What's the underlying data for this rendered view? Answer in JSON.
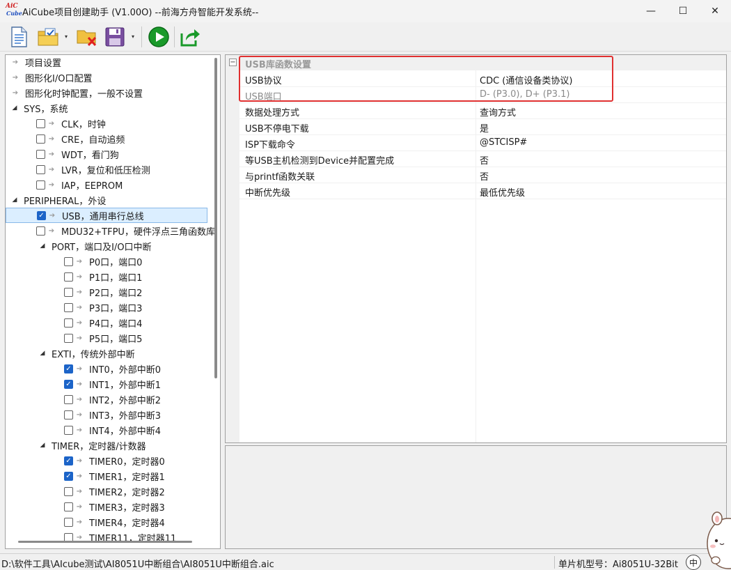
{
  "window": {
    "logo_top": "AiC",
    "logo_bottom": "Cube",
    "title": "AiCube项目创建助手 (V1.00O) --前海方舟智能开发系统--",
    "minimize_glyph": "—",
    "maximize_glyph": "☐",
    "close_glyph": "✕"
  },
  "toolbar": {
    "buttons": [
      "new-project-icon",
      "open-project-icon",
      "close-project-icon",
      "save-project-icon",
      "run-icon",
      "export-icon"
    ],
    "dropdown_glyph": "▾"
  },
  "tree": {
    "items": [
      {
        "label": "项目设置",
        "kind": "arrow"
      },
      {
        "label": "图形化I/O口配置",
        "kind": "arrow"
      },
      {
        "label": "图形化时钟配置，一般不设置",
        "kind": "arrow"
      },
      {
        "label": "SYS，系统",
        "kind": "expander"
      },
      {
        "label": "CLK，时钟",
        "kind": "check",
        "checked": false
      },
      {
        "label": "CRE，自动追频",
        "kind": "check",
        "checked": false
      },
      {
        "label": "WDT，看门狗",
        "kind": "check",
        "checked": false
      },
      {
        "label": "LVR，复位和低压检测",
        "kind": "check",
        "checked": false
      },
      {
        "label": "IAP，EEPROM",
        "kind": "check",
        "checked": false
      },
      {
        "label": "PERIPHERAL，外设",
        "kind": "expander"
      },
      {
        "label": "USB，通用串行总线",
        "kind": "check",
        "checked": true,
        "selected": true
      },
      {
        "label": "MDU32+TFPU，硬件浮点三角函数库",
        "kind": "check",
        "checked": false
      },
      {
        "label": "PORT，端口及I/O口中断",
        "kind": "expander"
      },
      {
        "label": "P0口，端口0",
        "kind": "check",
        "checked": false
      },
      {
        "label": "P1口，端口1",
        "kind": "check",
        "checked": false
      },
      {
        "label": "P2口，端口2",
        "kind": "check",
        "checked": false
      },
      {
        "label": "P3口，端口3",
        "kind": "check",
        "checked": false
      },
      {
        "label": "P4口，端口4",
        "kind": "check",
        "checked": false
      },
      {
        "label": "P5口，端口5",
        "kind": "check",
        "checked": false
      },
      {
        "label": "EXTI，传统外部中断",
        "kind": "expander"
      },
      {
        "label": "INT0，外部中断0",
        "kind": "check",
        "checked": true
      },
      {
        "label": "INT1，外部中断1",
        "kind": "check",
        "checked": true
      },
      {
        "label": "INT2，外部中断2",
        "kind": "check",
        "checked": false
      },
      {
        "label": "INT3，外部中断3",
        "kind": "check",
        "checked": false
      },
      {
        "label": "INT4，外部中断4",
        "kind": "check",
        "checked": false
      },
      {
        "label": "TIMER，定时器/计数器",
        "kind": "expander"
      },
      {
        "label": "TIMER0，定时器0",
        "kind": "check",
        "checked": true
      },
      {
        "label": "TIMER1，定时器1",
        "kind": "check",
        "checked": true
      },
      {
        "label": "TIMER2，定时器2",
        "kind": "check",
        "checked": false
      },
      {
        "label": "TIMER3，定时器3",
        "kind": "check",
        "checked": false
      },
      {
        "label": "TIMER4，定时器4",
        "kind": "check",
        "checked": false
      },
      {
        "label": "TIMER11，定时器11",
        "kind": "check",
        "checked": false
      }
    ]
  },
  "properties": {
    "category": "USB库函数设置",
    "collapse_glyph": "−",
    "rows": [
      {
        "name": "USB协议",
        "value": "CDC (通信设备类协议)",
        "readonly": false
      },
      {
        "name": "USB端口",
        "value": "D- (P3.0), D+ (P3.1)",
        "readonly": true
      },
      {
        "name": "数据处理方式",
        "value": "查询方式",
        "readonly": false
      },
      {
        "name": "USB不停电下载",
        "value": "是",
        "readonly": false
      },
      {
        "name": "ISP下载命令",
        "value": "@STCISP#",
        "readonly": false
      },
      {
        "name": "等USB主机检测到Device并配置完成",
        "value": "否",
        "readonly": false
      },
      {
        "name": "与printf函数关联",
        "value": "否",
        "readonly": false
      },
      {
        "name": "中断优先级",
        "value": "最低优先级",
        "readonly": false
      }
    ]
  },
  "status": {
    "path": "D:\\软件工具\\AIcube测试\\AI8051U中断组合\\AI8051U中断组合.aic",
    "mcu": "单片机型号：Ai8051U-32Bit",
    "ime": "中"
  },
  "colors": {
    "highlight": "#e03030",
    "check_blue": "#1c64c8",
    "selected_bg": "#dbeeff"
  }
}
